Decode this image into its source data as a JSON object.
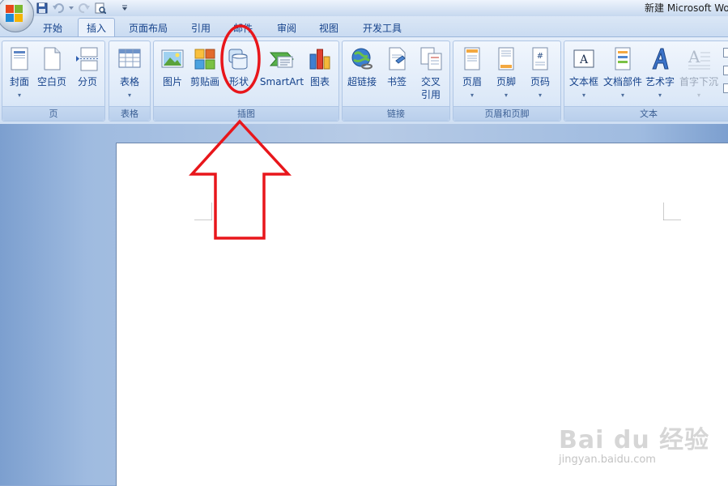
{
  "window": {
    "title": "新建 Microsoft Wo"
  },
  "tabs": [
    {
      "label": "开始"
    },
    {
      "label": "插入",
      "active": true
    },
    {
      "label": "页面布局"
    },
    {
      "label": "引用"
    },
    {
      "label": "邮件"
    },
    {
      "label": "审阅"
    },
    {
      "label": "视图"
    },
    {
      "label": "开发工具"
    }
  ],
  "ribbon": {
    "groups": {
      "pages": {
        "label": "页",
        "buttons": [
          "封面",
          "空白页",
          "分页"
        ]
      },
      "tables": {
        "label": "表格",
        "buttons": [
          "表格"
        ]
      },
      "illustrations": {
        "label": "插图",
        "buttons": [
          "图片",
          "剪贴画",
          "形状",
          "SmartArt",
          "图表"
        ]
      },
      "links": {
        "label": "链接",
        "buttons": [
          "超链接",
          "书签",
          "交叉",
          "引用"
        ]
      },
      "header_footer": {
        "label": "页眉和页脚",
        "buttons": [
          "页眉",
          "页脚",
          "页码"
        ]
      },
      "text": {
        "label": "文本",
        "buttons": [
          "文本框",
          "文档部件",
          "艺术字",
          "首字下沉"
        ]
      }
    }
  },
  "icons": {
    "office_button": "office-button-icon",
    "qat": [
      "save-icon",
      "undo-icon",
      "redo-icon",
      "print-preview-icon",
      "customize-icon"
    ]
  },
  "colors": {
    "annotation": "#e8161b",
    "ribbon_text": "#15428b",
    "page": "#ffffff",
    "workspace": "#9fbbe0"
  },
  "watermark": {
    "brand": "Bai du 经验",
    "url": "jingyan.baidu.com"
  }
}
